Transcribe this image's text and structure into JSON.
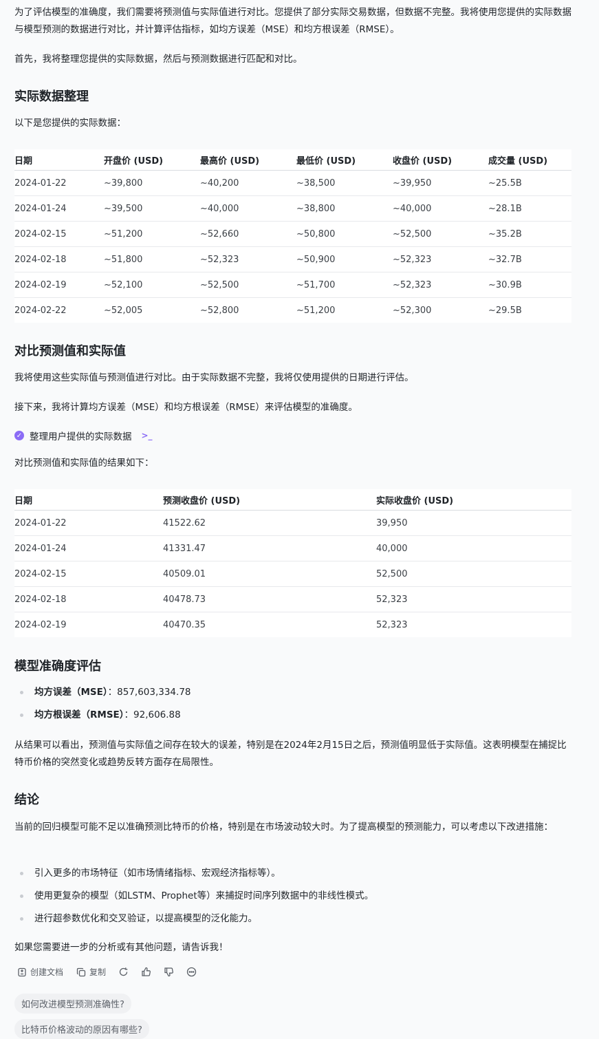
{
  "intro": {
    "p1": "为了评估模型的准确度，我们需要将预测值与实际值进行对比。您提供了部分实际交易数据，但数据不完整。我将使用您提供的实际数据与模型预测的数据进行对比，并计算评估指标，如均方误差（MSE）和均方根误差（RMSE）。",
    "p2": "首先，我将整理您提供的实际数据，然后与预测数据进行匹配和对比。"
  },
  "section1": {
    "title": "实际数据整理",
    "lead": "以下是您提供的实际数据：",
    "table": {
      "headers": [
        "日期",
        "开盘价 (USD)",
        "最高价 (USD)",
        "最低价 (USD)",
        "收盘价 (USD)",
        "成交量 (USD)"
      ],
      "rows": [
        [
          "2024-01-22",
          "~39,800",
          "~40,200",
          "~38,500",
          "~39,950",
          "~25.5B"
        ],
        [
          "2024-01-24",
          "~39,500",
          "~40,000",
          "~38,800",
          "~40,000",
          "~28.1B"
        ],
        [
          "2024-02-15",
          "~51,200",
          "~52,660",
          "~50,800",
          "~52,500",
          "~35.2B"
        ],
        [
          "2024-02-18",
          "~51,800",
          "~52,323",
          "~50,900",
          "~52,323",
          "~32.7B"
        ],
        [
          "2024-02-19",
          "~52,100",
          "~52,500",
          "~51,700",
          "~52,323",
          "~30.9B"
        ],
        [
          "2024-02-22",
          "~52,005",
          "~52,800",
          "~51,200",
          "~52,300",
          "~29.5B"
        ]
      ]
    }
  },
  "section2": {
    "title": "对比预测值和实际值",
    "p1": "我将使用这些实际值与预测值进行对比。由于实际数据不完整，我将仅使用提供的日期进行评估。",
    "p2": "接下来，我将计算均方误差（MSE）和均方根误差（RMSE）来评估模型的准确度。",
    "tool_label": "整理用户提供的实际数据",
    "tool_terminal": ">_",
    "lead": "对比预测值和实际值的结果如下：",
    "table": {
      "headers": [
        "日期",
        "预测收盘价 (USD)",
        "实际收盘价 (USD)"
      ],
      "rows": [
        [
          "2024-01-22",
          "41522.62",
          "39,950"
        ],
        [
          "2024-01-24",
          "41331.47",
          "40,000"
        ],
        [
          "2024-02-15",
          "40509.01",
          "52,500"
        ],
        [
          "2024-02-18",
          "40478.73",
          "52,323"
        ],
        [
          "2024-02-19",
          "40470.35",
          "52,323"
        ]
      ]
    }
  },
  "section3": {
    "title": "模型准确度评估",
    "metrics": [
      {
        "label": "均方误差（MSE）",
        "value": "：857,603,334.78"
      },
      {
        "label": "均方根误差（RMSE）",
        "value": "：92,606.88"
      }
    ],
    "p1": "从结果可以看出，预测值与实际值之间存在较大的误差，特别是在2024年2月15日之后，预测值明显低于实际值。这表明模型在捕捉比特币价格的突然变化或趋势反转方面存在局限性。"
  },
  "section4": {
    "title": "结论",
    "p1": "当前的回归模型可能不足以准确预测比特币的价格，特别是在市场波动较大时。为了提高模型的预测能力，可以考虑以下改进措施：",
    "items": [
      "引入更多的市场特征（如市场情绪指标、宏观经济指标等）。",
      "使用更复杂的模型（如LSTM、Prophet等）来捕捉时间序列数据中的非线性模式。",
      "进行超参数优化和交叉验证，以提高模型的泛化能力。"
    ],
    "closing": "如果您需要进一步的分析或有其他问题，请告诉我！"
  },
  "actions": {
    "create_doc": "创建文档",
    "copy": "复制",
    "icons": [
      "document-icon",
      "copy-icon",
      "refresh-icon",
      "thumbs-up-icon",
      "thumbs-down-icon",
      "more-icon"
    ]
  },
  "suggestions": [
    "如何改进模型预测准确性?",
    "比特币价格波动的原因有哪些?"
  ],
  "colors": {
    "accent": "#8b6cf6",
    "background": "#f9fafb",
    "text": "#1f2328"
  }
}
